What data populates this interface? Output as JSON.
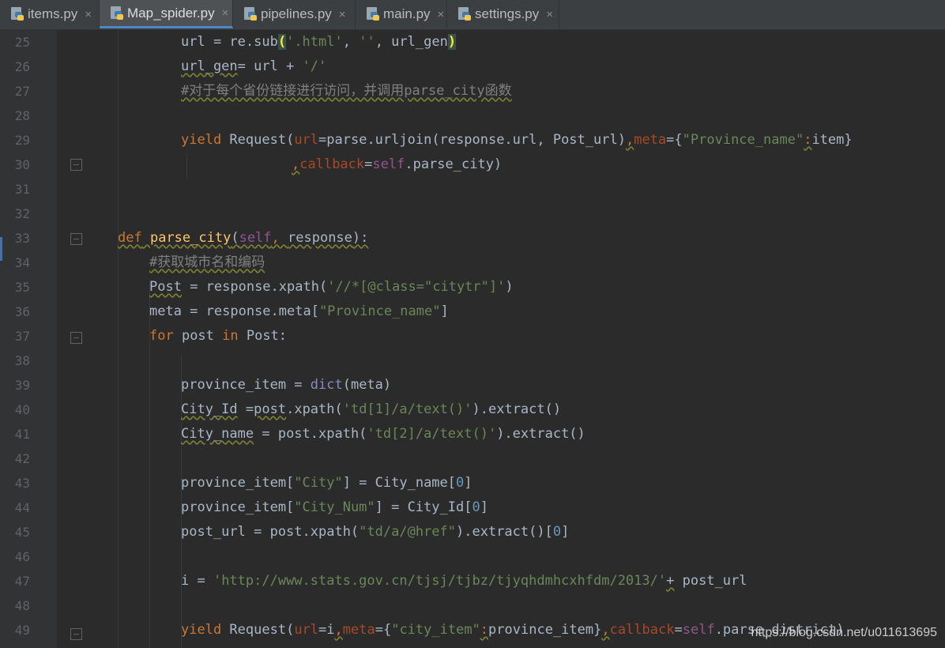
{
  "tabs": [
    {
      "label": "items.py",
      "active": false
    },
    {
      "label": "Map_spider.py",
      "active": true
    },
    {
      "label": "pipelines.py",
      "active": false
    },
    {
      "label": "main.py",
      "active": false
    },
    {
      "label": "settings.py",
      "active": false
    }
  ],
  "close_glyph": "×",
  "line_numbers": [
    "25",
    "26",
    "27",
    "28",
    "29",
    "30",
    "31",
    "32",
    "33",
    "34",
    "35",
    "36",
    "37",
    "38",
    "39",
    "40",
    "41",
    "42",
    "43",
    "44",
    "45",
    "46",
    "47",
    "48",
    "49"
  ],
  "code": {
    "l25": [
      "url = re.sub",
      "(",
      "'.html'",
      ", ",
      "''",
      ", url_gen",
      ")"
    ],
    "l26": [
      "url_gen",
      "= url + ",
      "'/'"
    ],
    "l27": "#对于每个省份链接进行访问，并调用parse_city函数",
    "l29": [
      "yield",
      " Request(",
      "url",
      "=parse.urljoin(response.url, Post_url)",
      ",",
      "meta",
      "={",
      "\"Province_name\"",
      ":",
      "item}"
    ],
    "l30": [
      ",",
      "callback",
      "=",
      "self",
      ".parse_city)"
    ],
    "l33": [
      "def",
      " ",
      "parse_city",
      "(",
      "self",
      ", ",
      "response",
      "):"
    ],
    "l34": "#获取城市名和编码",
    "l35": [
      "Post",
      " = response.xpath(",
      "'//*[@class=\"citytr\"]'",
      ")"
    ],
    "l36": [
      "meta = response.meta[",
      "\"Province_name\"",
      "]"
    ],
    "l37": [
      "for",
      " post ",
      "in",
      " Post:"
    ],
    "l39": [
      "province_item = ",
      "dict",
      "(meta)"
    ],
    "l40": [
      "City_Id",
      " =",
      "post",
      ".xpath(",
      "'td[1]/a/text()'",
      ").extract()"
    ],
    "l41": [
      "City_name",
      " = post.xpath(",
      "'td[2]/a/text()'",
      ").extract()"
    ],
    "l43": [
      "province_item[",
      "\"City\"",
      "] = City_name[",
      "0",
      "]"
    ],
    "l44": [
      "province_item[",
      "\"City_Num\"",
      "] = City_Id[",
      "0",
      "]"
    ],
    "l45": [
      "post_url = post.xpath(",
      "\"td/a/@href\"",
      ").extract()[",
      "0",
      "]"
    ],
    "l47": [
      "i = ",
      "'http://www.stats.gov.cn/tjsj/tjbz/tjyqhdmhcxhfdm/2013/'",
      "+",
      " post_url"
    ],
    "l49": [
      "yield",
      " Request(",
      "url",
      "=i",
      ",",
      "meta",
      "={",
      "\"city_item\"",
      ":",
      "province_item}",
      ",",
      "callback",
      "=",
      "self",
      ".parse_district)"
    ]
  },
  "watermark": "https://blog.csdn.net/u011613695",
  "colors": {
    "background": "#2b2b2b",
    "keyword": "#cc7832",
    "string": "#6a8759",
    "comment": "#808080",
    "function": "#ffc66d",
    "number": "#6897bb",
    "self": "#94558d"
  }
}
